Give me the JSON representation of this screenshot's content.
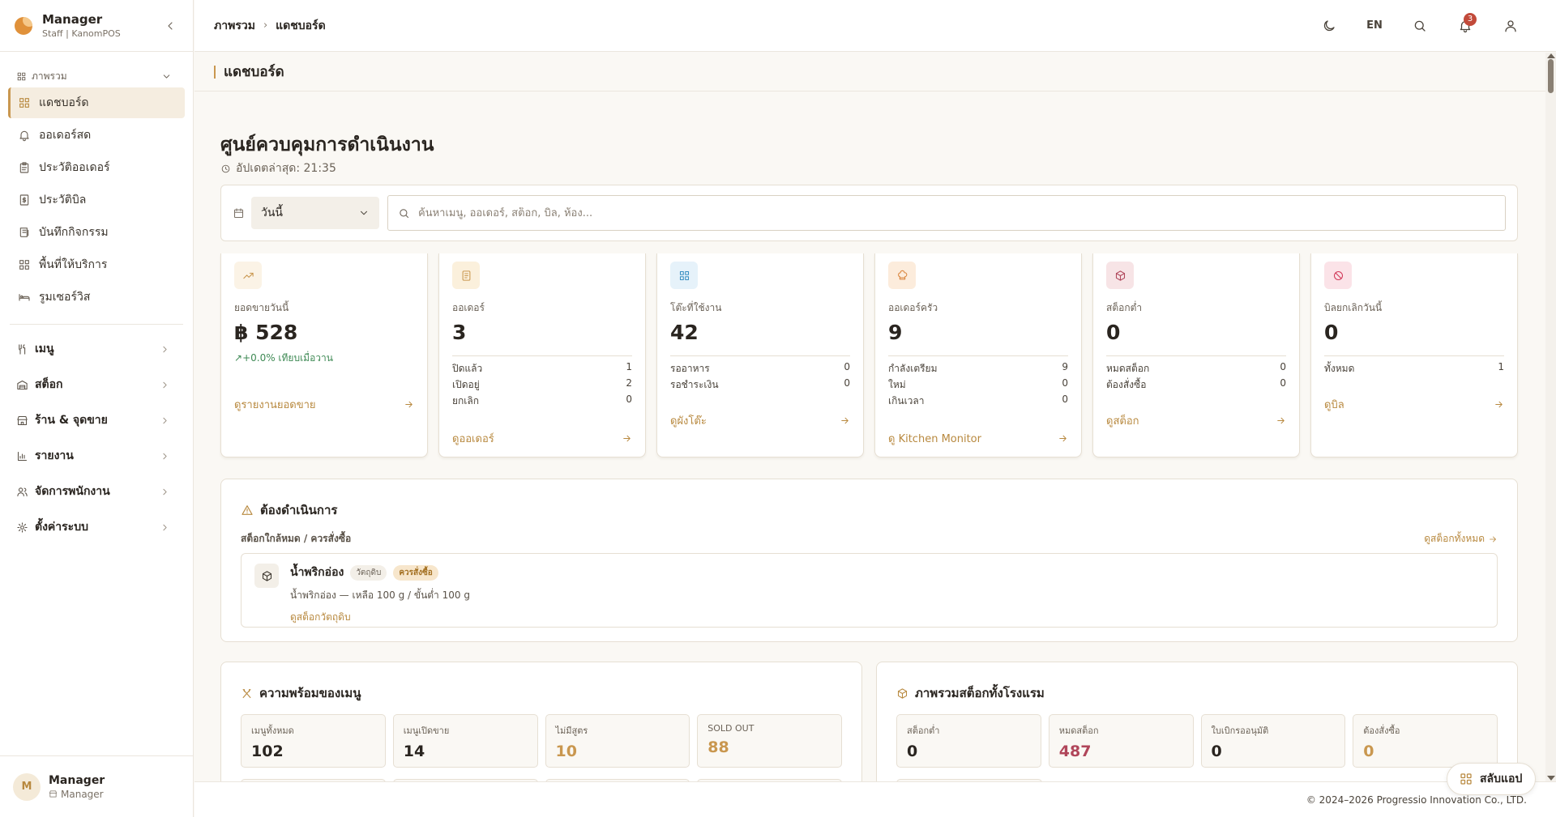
{
  "brand": {
    "name": "Manager",
    "sub": "Staff | KanomPOS"
  },
  "sidebar": {
    "group_label": "ภาพรวม",
    "items": [
      {
        "label": "แดชบอร์ด",
        "icon": "grid-icon",
        "active": true
      },
      {
        "label": "ออเดอร์สด",
        "icon": "bell-icon"
      },
      {
        "label": "ประวัติออเดอร์",
        "icon": "clipboard-icon"
      },
      {
        "label": "ประวัติบิล",
        "icon": "receipt-icon"
      },
      {
        "label": "บันทึกกิจกรรม",
        "icon": "log-icon"
      },
      {
        "label": "พื้นที่ให้บริการ",
        "icon": "layout-icon"
      },
      {
        "label": "รูมเซอร์วิส",
        "icon": "bed-icon"
      }
    ],
    "sections": [
      {
        "label": "เมนู",
        "icon": "utensils-icon"
      },
      {
        "label": "สต็อก",
        "icon": "warehouse-icon"
      },
      {
        "label": "ร้าน & จุดขาย",
        "icon": "store-icon"
      },
      {
        "label": "รายงาน",
        "icon": "chart-icon"
      },
      {
        "label": "จัดการพนักงาน",
        "icon": "users-icon"
      },
      {
        "label": "ตั้งค่าระบบ",
        "icon": "gear-icon"
      }
    ],
    "user": {
      "initial": "M",
      "name": "Manager",
      "role": "Manager"
    }
  },
  "header": {
    "breadcrumb": [
      "ภาพรวม",
      "แดชบอร์ด"
    ],
    "lang": "EN",
    "notif_count": "3"
  },
  "subheader": {
    "title": "แดชบอร์ด"
  },
  "page": {
    "title": "ศูนย์ควบคุมการดำเนินงาน",
    "updated": "อัปเดตล่าสุด: 21:35",
    "date_filter": "วันนี้",
    "search_placeholder": "ค้นหาเมนู, ออเดอร์, สต็อก, บิล, ห้อง..."
  },
  "kpis": [
    {
      "label": "ยอดขายวันนี้",
      "value": "฿ 528",
      "trend": "+0.0% เทียบเมื่อวาน",
      "rows": [],
      "link": "ดูรายงานยอดขาย",
      "icon": "trending-up-icon",
      "color": "#c9974f",
      "bg": "#fbf3e6"
    },
    {
      "label": "ออเดอร์",
      "value": "3",
      "rows": [
        {
          "k": "ปิดแล้ว",
          "v": "1"
        },
        {
          "k": "เปิดอยู่",
          "v": "2"
        },
        {
          "k": "ยกเลิก",
          "v": "0"
        }
      ],
      "link": "ดูออเดอร์",
      "icon": "document-icon",
      "color": "#c9974f",
      "bg": "#fbf0dc"
    },
    {
      "label": "โต๊ะที่ใช้งาน",
      "value": "42",
      "rows": [
        {
          "k": "รออาหาร",
          "v": "0"
        },
        {
          "k": "รอชำระเงิน",
          "v": "0"
        }
      ],
      "link": "ดูผังโต๊ะ",
      "icon": "table-grid-icon",
      "color": "#3a8fc2",
      "bg": "#e6f2fa"
    },
    {
      "label": "ออเดอร์ครัว",
      "value": "9",
      "rows": [
        {
          "k": "กำลังเตรียม",
          "v": "9"
        },
        {
          "k": "ใหม่",
          "v": "0"
        },
        {
          "k": "เกินเวลา",
          "v": "0"
        }
      ],
      "link": "ดู Kitchen Monitor",
      "icon": "chef-hat-icon",
      "color": "#d9833a",
      "bg": "#fcecdc"
    },
    {
      "label": "สต็อกต่ำ",
      "value": "0",
      "rows": [
        {
          "k": "หมดสต็อก",
          "v": "0"
        },
        {
          "k": "ต้องสั่งซื้อ",
          "v": "0"
        }
      ],
      "link": "ดูสต็อก",
      "icon": "box-icon",
      "color": "#b0465a",
      "bg": "#f7e4e6"
    },
    {
      "label": "บิลยกเลิกวันนี้",
      "value": "0",
      "rows": [
        {
          "k": "ทั้งหมด",
          "v": "1"
        }
      ],
      "link": "ดูบิล",
      "icon": "ban-icon",
      "color": "#d23a5a",
      "bg": "#fbe3e8"
    }
  ],
  "attention": {
    "title": "ต้องดำเนินการ",
    "subtitle": "สต็อกใกล้หมด / ควรสั่งซื้อ",
    "view_all": "ดูสต็อกทั้งหมด",
    "item": {
      "name": "น้ำพริกอ่อง",
      "tag1": "วัตถุดิบ",
      "tag2": "ควรสั่งซื้อ",
      "desc": "น้ำพริกอ่อง — เหลือ 100 g / ขั้นต่ำ 100 g",
      "link": "ดูสต็อกวัตถุดิบ"
    }
  },
  "menu_panel": {
    "title": "ความพร้อมของเมนู",
    "stats": [
      {
        "label": "เมนูทั้งหมด",
        "value": "102",
        "color": "#2a2520"
      },
      {
        "label": "เมนูเปิดขาย",
        "value": "14",
        "color": "#2a2520"
      },
      {
        "label": "ไม่มีสูตร",
        "value": "10",
        "color": "#c9974f"
      },
      {
        "label": "SOLD OUT",
        "value": "88",
        "color": "#c9974f"
      }
    ]
  },
  "stock_panel": {
    "title": "ภาพรวมสต็อกทั้งโรงแรม",
    "stats": [
      {
        "label": "สต็อกต่ำ",
        "value": "0",
        "color": "#2a2520"
      },
      {
        "label": "หมดสต็อก",
        "value": "487",
        "color": "#b0465a"
      },
      {
        "label": "ใบเบิกรออนุมัติ",
        "value": "0",
        "color": "#2a2520"
      },
      {
        "label": "ต้องสั่งซื้อ",
        "value": "0",
        "color": "#c9974f"
      }
    ]
  },
  "footer": {
    "copyright": "© 2024–2026 Progressio Innovation Co., LTD."
  },
  "switch_app": "สลับแอป"
}
